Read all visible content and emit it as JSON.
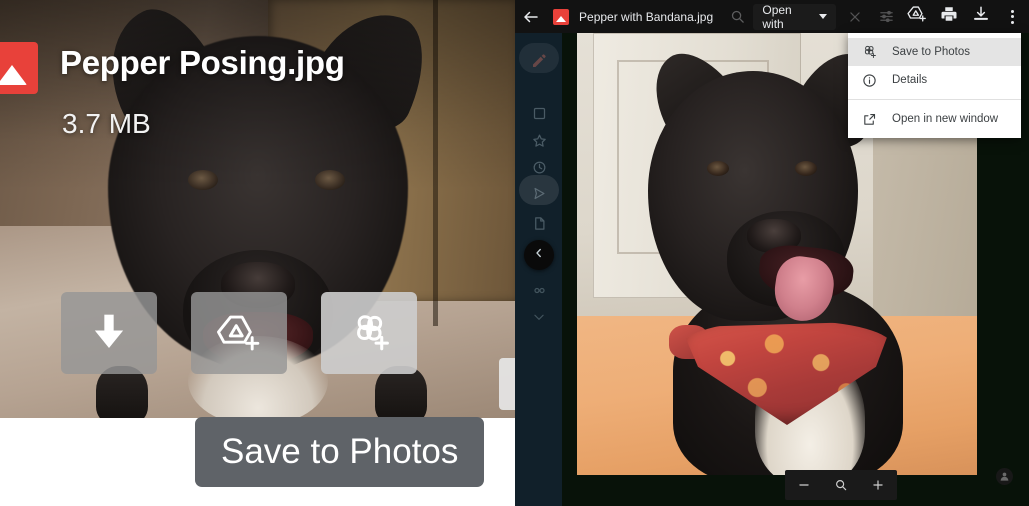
{
  "left_panel": {
    "file_icon": "image-file-icon",
    "title": "Pepper Posing.jpg",
    "size": "3.7 MB",
    "actions": [
      {
        "name": "download-button",
        "icon": "download-arrow-icon"
      },
      {
        "name": "save-to-drive-button",
        "icon": "drive-plus-icon"
      },
      {
        "name": "save-to-photos-button",
        "icon": "photos-pinwheel-plus-icon"
      }
    ],
    "tooltip": "Save to Photos",
    "next_button": "next-image-button"
  },
  "right_panel": {
    "topbar": {
      "back": "back-arrow-icon",
      "file_icon": "image-file-icon",
      "filename": "Pepper with Bandana.jpg",
      "search": "search-icon",
      "open_with_label": "Open with",
      "open_with_caret": "chevron-down-icon",
      "close": "close-icon",
      "tune": "tune-sliders-icon",
      "right_icons": [
        {
          "name": "save-to-drive-button",
          "icon": "drive-plus-icon"
        },
        {
          "name": "print-button",
          "icon": "printer-icon"
        },
        {
          "name": "download-button",
          "icon": "download-tray-icon"
        },
        {
          "name": "more-options-button",
          "icon": "three-dot-menu-icon"
        }
      ]
    },
    "rail": {
      "items": [
        {
          "name": "rail-item-edit",
          "icon": "pencil-icon"
        },
        {
          "name": "rail-item-tasks",
          "icon": "square-icon"
        },
        {
          "name": "rail-item-starred",
          "icon": "star-icon"
        },
        {
          "name": "rail-item-recent",
          "icon": "clock-icon"
        },
        {
          "name": "rail-item-send",
          "icon": "send-icon"
        },
        {
          "name": "rail-item-file",
          "icon": "file-icon"
        },
        {
          "name": "rail-item-cut",
          "icon": "scissors-icon"
        },
        {
          "name": "rail-item-contacts",
          "icon": "contacts-icon"
        },
        {
          "name": "rail-item-expand",
          "icon": "chevron-down-icon"
        }
      ],
      "collapse": "chevron-left-icon"
    },
    "menu": {
      "items": [
        {
          "label": "Save to Photos",
          "icon": "photos-pinwheel-plus-icon",
          "active": true
        },
        {
          "label": "Details",
          "icon": "info-circle-icon",
          "active": false
        },
        {
          "label": "Open in new window",
          "icon": "open-in-new-icon",
          "active": false
        }
      ]
    },
    "zoom_controls": [
      {
        "name": "zoom-out-button",
        "icon": "minus-icon"
      },
      {
        "name": "zoom-fit-button",
        "icon": "magnifier-icon"
      },
      {
        "name": "zoom-in-button",
        "icon": "plus-icon"
      }
    ],
    "avatar": "account-avatar-icon"
  },
  "colors": {
    "accent_red": "#e8413a",
    "tooltip_bg": "#5f6368",
    "menu_bg": "#ffffff",
    "menu_active": "#e4e4e4",
    "rail_bg": "#11202a",
    "topbar_bg": "#121212"
  }
}
